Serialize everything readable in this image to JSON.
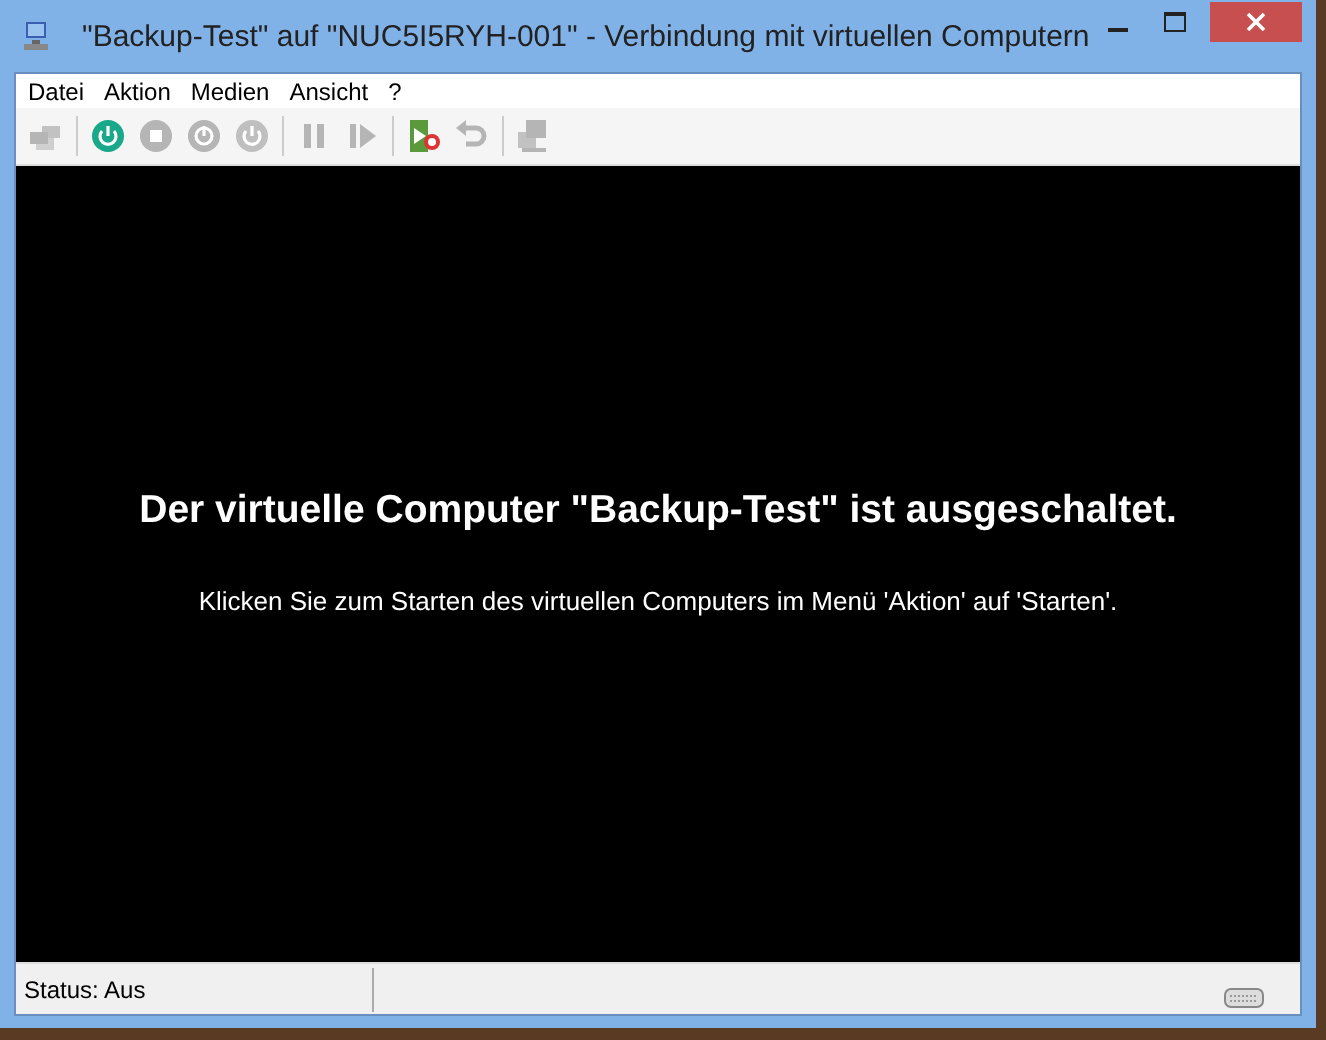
{
  "window": {
    "title": "\"Backup-Test\" auf \"NUC5I5RYH-001\" - Verbindung mit virtuellen Computern"
  },
  "menu": [
    "Datei",
    "Aktion",
    "Medien",
    "Ansicht",
    "?"
  ],
  "toolbar": [
    {
      "kind": "ctrl-alt-del",
      "disabled": true
    },
    {
      "kind": "start",
      "disabled": false
    },
    {
      "kind": "turn-off",
      "disabled": true
    },
    {
      "kind": "shut-down",
      "disabled": true
    },
    {
      "kind": "save",
      "disabled": true
    },
    {
      "kind": "pause",
      "disabled": true
    },
    {
      "kind": "resume",
      "disabled": true
    },
    {
      "kind": "checkpoint",
      "disabled": false
    },
    {
      "kind": "revert",
      "disabled": true
    },
    {
      "kind": "enhanced",
      "disabled": true
    }
  ],
  "screen": {
    "heading": "Der virtuelle Computer \"Backup-Test\" ist ausgeschaltet.",
    "hint": "Klicken Sie zum Starten des virtuellen Computers im Menü 'Aktion' auf 'Starten'."
  },
  "status_bar": {
    "text": "Status: Aus"
  }
}
